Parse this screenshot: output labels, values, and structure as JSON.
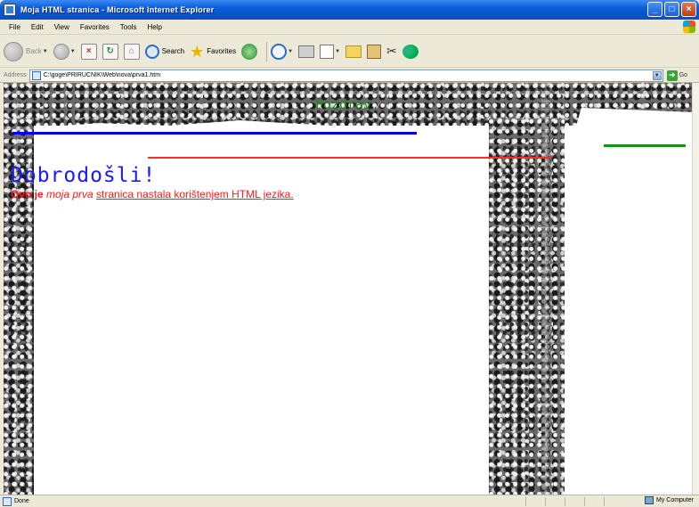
{
  "window": {
    "title": "Moja HTML stranica - Microsoft Internet Explorer",
    "controls": {
      "minimize": "_",
      "maximize": "□",
      "close": "×"
    }
  },
  "menu": {
    "items": [
      "File",
      "Edit",
      "View",
      "Favorites",
      "Tools",
      "Help"
    ]
  },
  "toolbar": {
    "back": "Back",
    "search": "Search",
    "favorites": "Favorites"
  },
  "address": {
    "label": "Address",
    "value": "C:\\goge\\PRIRUČNIK\\Web\\nova\\prva1.htm",
    "go": "Go"
  },
  "page": {
    "greeting": "Pozdrav.",
    "welcome": "Dobrodošli!",
    "intro_pre": "Ovo je ",
    "intro_em": "moja prva",
    "intro_link": "stranica nastala korištenjem HTML jezika.",
    "colors": {
      "greeting": "#1f8a1f",
      "blue_line": "#0000ee",
      "red_line": "#ff2a2a",
      "green_line": "#149414",
      "welcome": "#1a1aff",
      "intro": "#ff1a1a"
    }
  },
  "status": {
    "text": "Done",
    "zone": "My Computer"
  },
  "icons": [
    "ie-app-icon",
    "back-icon",
    "forward-icon",
    "stop-icon",
    "refresh-icon",
    "home-icon",
    "search-icon",
    "star-icon",
    "history-icon",
    "mail-icon",
    "print-icon",
    "edit-icon",
    "folder-icon",
    "research-icon",
    "tool-icon",
    "messenger-icon",
    "page-icon",
    "go-icon",
    "computer-icon",
    "windows-logo-icon"
  ]
}
